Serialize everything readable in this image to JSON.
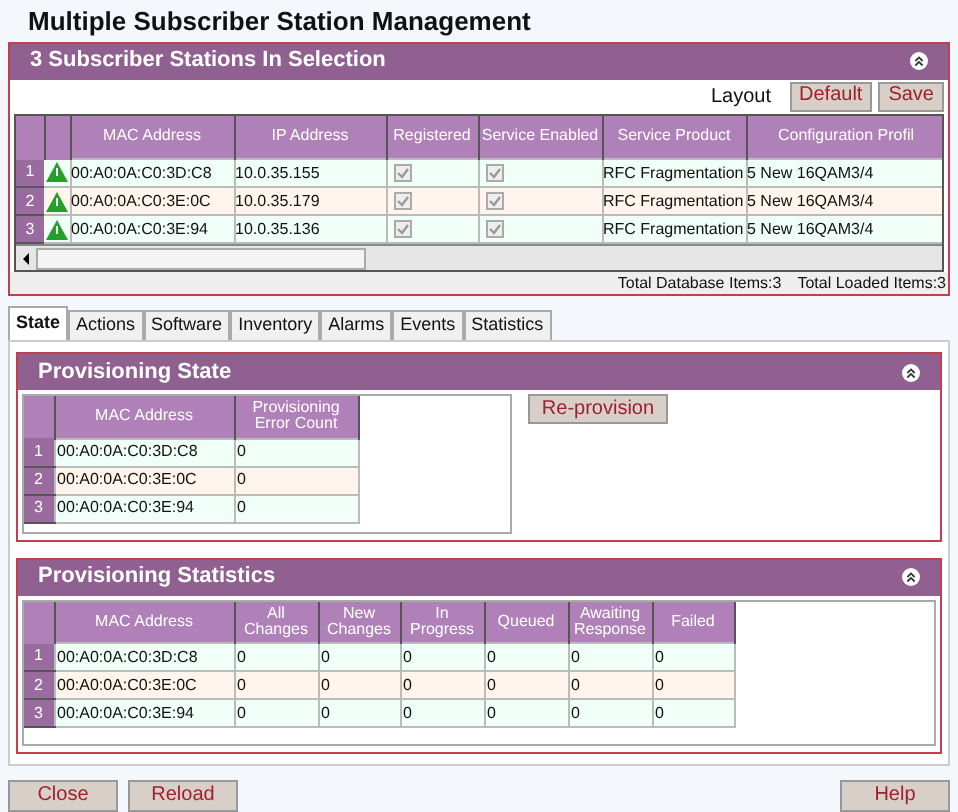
{
  "title": "Multiple Subscriber Station Management",
  "selection": {
    "title": "3 Subscriber Stations In Selection",
    "layout_label": "Layout",
    "layout_buttons": [
      "Default",
      "Save"
    ],
    "columns": [
      "MAC Address",
      "IP Address",
      "Registered",
      "Service Enabled",
      "Service Product",
      "Configuration Profil"
    ],
    "rows": [
      {
        "number": "1",
        "mac": "00:A0:0A:C0:3D:C8",
        "ip": "10.0.35.155",
        "registered": true,
        "service_enabled": true,
        "product": "RFC Fragmentation",
        "profile": "5 New 16QAM3/4"
      },
      {
        "number": "2",
        "mac": "00:A0:0A:C0:3E:0C",
        "ip": "10.0.35.179",
        "registered": true,
        "service_enabled": true,
        "product": "RFC Fragmentation",
        "profile": "5 New 16QAM3/4"
      },
      {
        "number": "3",
        "mac": "00:A0:0A:C0:3E:94",
        "ip": "10.0.35.136",
        "registered": true,
        "service_enabled": true,
        "product": "RFC Fragmentation",
        "profile": "5 New 16QAM3/4"
      }
    ],
    "totals": [
      "Total Database Items:3",
      "Total Loaded Items:3"
    ]
  },
  "tabs": [
    {
      "label": "State",
      "selected": true
    },
    {
      "label": "Actions",
      "selected": false
    },
    {
      "label": "Software",
      "selected": false
    },
    {
      "label": "Inventory",
      "selected": false
    },
    {
      "label": "Alarms",
      "selected": false
    },
    {
      "label": "Events",
      "selected": false
    },
    {
      "label": "Statistics",
      "selected": false
    }
  ],
  "provisioning_state": {
    "title": "Provisioning State",
    "columns": [
      "MAC Address",
      "Provisioning Error Count"
    ],
    "rows": [
      {
        "number": "1",
        "cells": [
          "00:A0:0A:C0:3D:C8",
          "0"
        ]
      },
      {
        "number": "2",
        "cells": [
          "00:A0:0A:C0:3E:0C",
          "0"
        ]
      },
      {
        "number": "3",
        "cells": [
          "00:A0:0A:C0:3E:94",
          "0"
        ]
      }
    ],
    "button": "Re-provision"
  },
  "provisioning_statistics": {
    "title": "Provisioning Statistics",
    "columns": [
      "MAC Address",
      "All Changes",
      "New Changes",
      "In Progress",
      "Queued",
      "Awaiting Response",
      "Failed"
    ],
    "rows": [
      {
        "number": "1",
        "cells": [
          "00:A0:0A:C0:3D:C8",
          "0",
          "0",
          "0",
          "0",
          "0",
          "0"
        ]
      },
      {
        "number": "2",
        "cells": [
          "00:A0:0A:C0:3E:0C",
          "0",
          "0",
          "0",
          "0",
          "0",
          "0"
        ]
      },
      {
        "number": "3",
        "cells": [
          "00:A0:0A:C0:3E:94",
          "0",
          "0",
          "0",
          "0",
          "0",
          "0"
        ]
      }
    ]
  },
  "footer_buttons": [
    "Close",
    "Reload",
    "Help"
  ]
}
